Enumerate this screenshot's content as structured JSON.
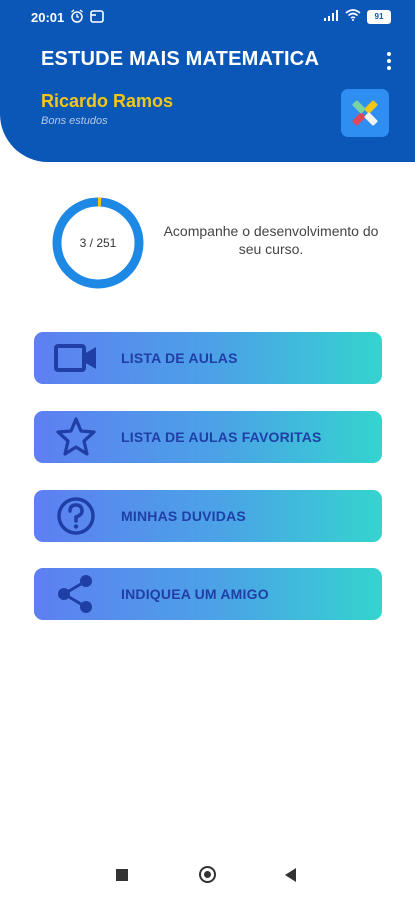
{
  "status_bar": {
    "time": "20:01",
    "battery": "91",
    "icons": [
      "alarm-icon",
      "app-notification-icon",
      "signal-icon",
      "wifi-icon",
      "battery-icon"
    ]
  },
  "header": {
    "title": "ESTUDE MAIS MATEMATICA",
    "user_name": "Ricardo Ramos",
    "user_subtitle": "Bons estudos",
    "menu_icon": "more-vert-icon",
    "colors": {
      "background": "#0a57b8",
      "user_name": "#f5c518"
    }
  },
  "progress": {
    "label": "3 / 251",
    "completed": 3,
    "total": 251,
    "description": "Acompanhe o desenvolvimento do seu curso.",
    "colors": {
      "track": "#1e88e5",
      "fill": "#f5c518"
    }
  },
  "menu": {
    "items": [
      {
        "label": "LISTA DE AULAS",
        "icon": "video-camera-icon"
      },
      {
        "label": "LISTA DE AULAS FAVORITAS",
        "icon": "star-icon"
      },
      {
        "label": "MINHAS DUVIDAS",
        "icon": "help-circle-icon"
      },
      {
        "label": "INDIQUEA UM AMIGO",
        "icon": "share-icon"
      }
    ],
    "colors": {
      "gradient_start": "#5e7ff2",
      "gradient_end": "#34d4cf",
      "text": "#1f3fa6"
    }
  },
  "nav_bar": {
    "icons": [
      "recent-apps-icon",
      "home-icon",
      "back-icon"
    ]
  }
}
